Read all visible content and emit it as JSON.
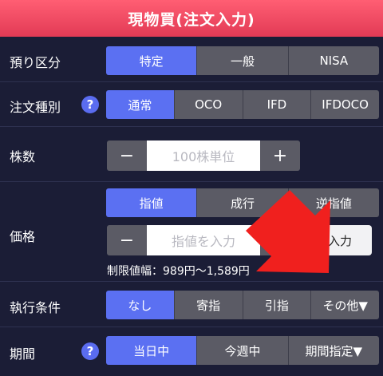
{
  "header": {
    "title": "現物買(注文入力)"
  },
  "account": {
    "label": "預り区分",
    "options": [
      "特定",
      "一般",
      "NISA"
    ],
    "selected": 0
  },
  "order_type": {
    "label": "注文種別",
    "help": "?",
    "options": [
      "通常",
      "OCO",
      "IFD",
      "IFDOCO"
    ],
    "selected": 0
  },
  "quantity": {
    "label": "株数",
    "minus": "−",
    "plus": "+",
    "placeholder": "100株単位"
  },
  "price": {
    "label": "価格",
    "options": [
      "指値",
      "成行",
      "逆指値"
    ],
    "selected": 0,
    "minus": "−",
    "plus": "+",
    "placeholder": "指値を入力",
    "input_button": "入力",
    "limit_text": "制限値幅：989円〜1,589円"
  },
  "condition": {
    "label": "執行条件",
    "options": [
      "なし",
      "寄指",
      "引指",
      "その他▼"
    ],
    "selected": 0
  },
  "period": {
    "label": "期間",
    "help": "?",
    "options": [
      "当日中",
      "今週中",
      "期間指定▼"
    ],
    "selected": 0
  },
  "colors": {
    "header": "#e23a55",
    "accent": "#5b70f2",
    "annotation_arrow": "#f0201e"
  }
}
